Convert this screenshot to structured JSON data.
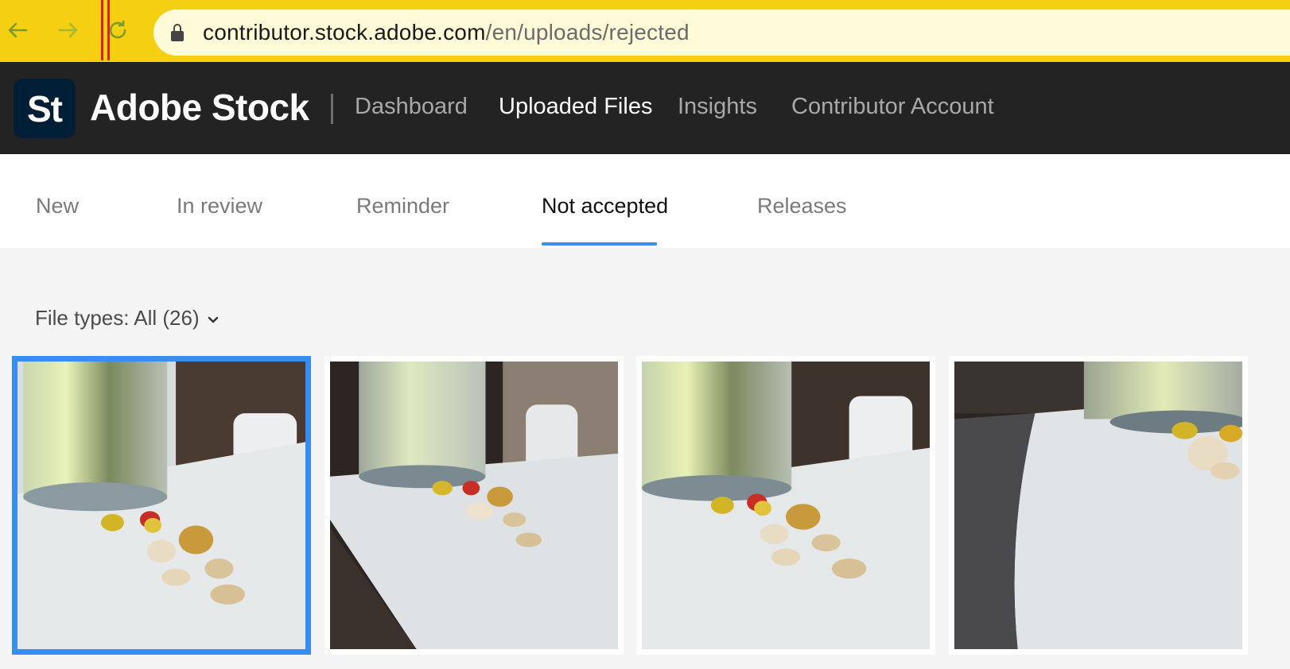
{
  "browser": {
    "url_domain": "contributor.stock.adobe.com",
    "url_path": "/en/uploads/rejected",
    "icons": [
      "back-arrow-icon",
      "forward-arrow-icon",
      "reload-icon",
      "lock-icon"
    ],
    "accent": "#f5cf12"
  },
  "header": {
    "logo_text": "St",
    "brand": "Adobe Stock",
    "nav": {
      "dashboard": "Dashboard",
      "uploaded_files": "Uploaded Files",
      "insights": "Insights",
      "contributor_account": "Contributor Account"
    },
    "active_nav": "Uploaded Files"
  },
  "tabs": {
    "new": "New",
    "in_review": "In review",
    "reminder": "Reminder",
    "not_accepted": "Not accepted",
    "releases": "Releases",
    "active": "Not accepted",
    "accent": "#378ef0"
  },
  "filter": {
    "label": "File types: All (26)",
    "icon": "chevron-down-icon"
  },
  "thumbnails": [
    {
      "subject": "glass of water with pills",
      "selected": true
    },
    {
      "subject": "glass of water with pills",
      "selected": false
    },
    {
      "subject": "glass of water with pills",
      "selected": false
    },
    {
      "subject": "glass of water with pills",
      "selected": false
    }
  ]
}
